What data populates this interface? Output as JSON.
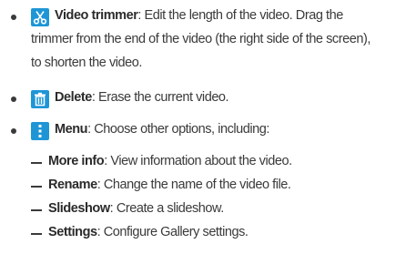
{
  "items": [
    {
      "icon": "scissors-icon",
      "title": "Video trimmer",
      "desc_lines": [
        ": Edit the length of the video. Drag the",
        "trimmer from the end of the video (the right side of the screen),",
        "to shorten the video."
      ]
    },
    {
      "icon": "trash-icon",
      "title": "Delete",
      "desc": ": Erase the current video."
    },
    {
      "icon": "more-vertical-icon",
      "title": "Menu",
      "desc": ": Choose other options, including:",
      "subitems": [
        {
          "title": "More info",
          "desc": ": View information about the video."
        },
        {
          "title": "Rename",
          "desc": ": Change the name of the video file."
        },
        {
          "title": "Slideshow",
          "desc": ": Create a slideshow."
        },
        {
          "title": "Settings",
          "desc": ": Configure Gallery settings."
        }
      ]
    }
  ],
  "colors": {
    "icon_bg": "#1e96d6",
    "text": "#3a3a3a"
  }
}
